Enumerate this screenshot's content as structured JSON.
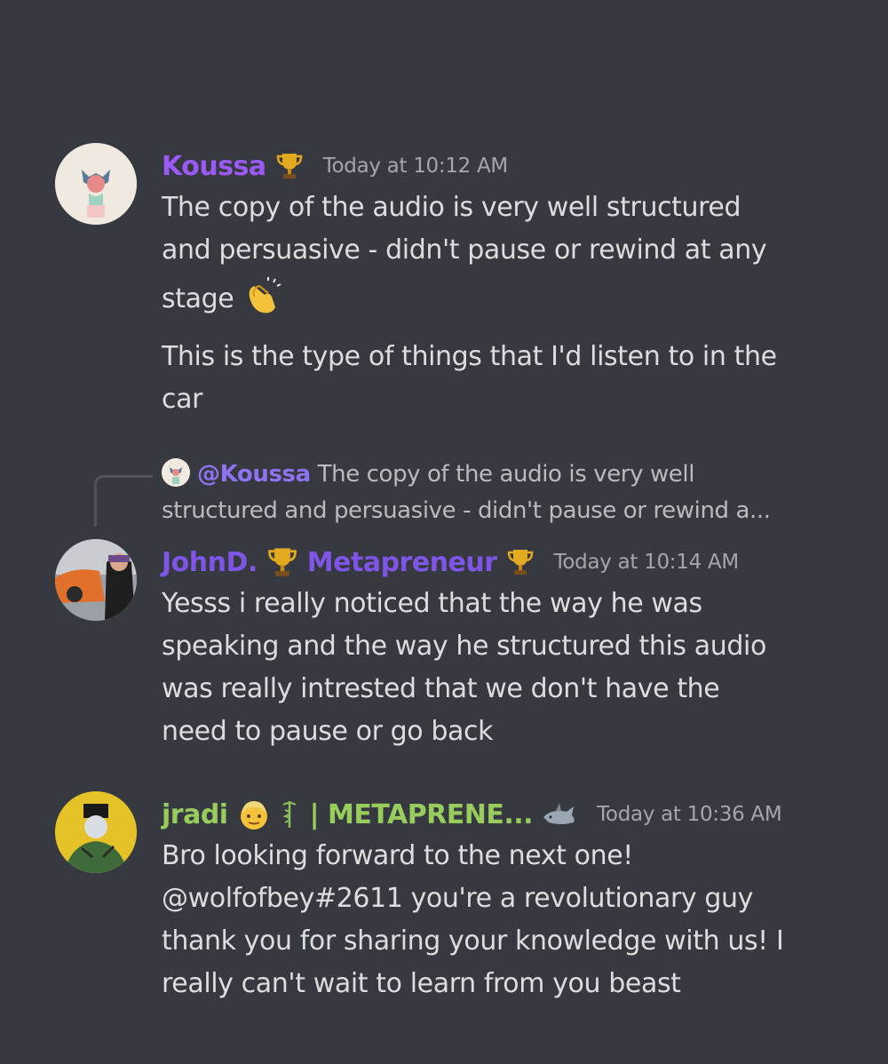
{
  "colors": {
    "background": "#36393f",
    "koussa_name": "#9b59f6",
    "johnd_name": "#7f55e8",
    "jradi_name": "#98cc5c",
    "timestamp": "#a3a6aa",
    "text": "#dcddde"
  },
  "messages": [
    {
      "author": "Koussa",
      "badges": [
        "trophy-icon"
      ],
      "timestamp": "Today at 10:12 AM",
      "lines": [
        "The copy of the audio is very well structured",
        "and persuasive - didn't pause or rewind at any",
        "stage",
        "This is the type of things that I'd listen to in the",
        "car"
      ],
      "inline_emoji": "clapping-hands-icon"
    },
    {
      "reply_to": {
        "mention": "@Koussa",
        "line1": "The copy of the audio is very well",
        "line2": "structured and persuasive - didn't pause or rewind a..."
      },
      "author": "JohnD.",
      "author_suffix": "Metapreneur",
      "badges": [
        "trophy-icon",
        "trophy-icon"
      ],
      "timestamp": "Today at 10:14 AM",
      "lines": [
        "Yesss i really noticed that the way he was",
        "speaking and the way he structured this audio",
        "was really intrested that we don't have the",
        "need to pause or go back"
      ]
    },
    {
      "author": "jradi",
      "author_suffix": "| METAPRENE...",
      "badges": [
        "person-emoji-icon",
        "caduceus-icon",
        "shark-icon"
      ],
      "timestamp": "Today at 10:36 AM",
      "lines": [
        "Bro looking forward to the next one!",
        "@wolfofbey#2611 you're a revolutionary guy",
        "thank you for sharing your knowledge with us! I",
        "really can't wait to learn from you beast"
      ]
    }
  ]
}
